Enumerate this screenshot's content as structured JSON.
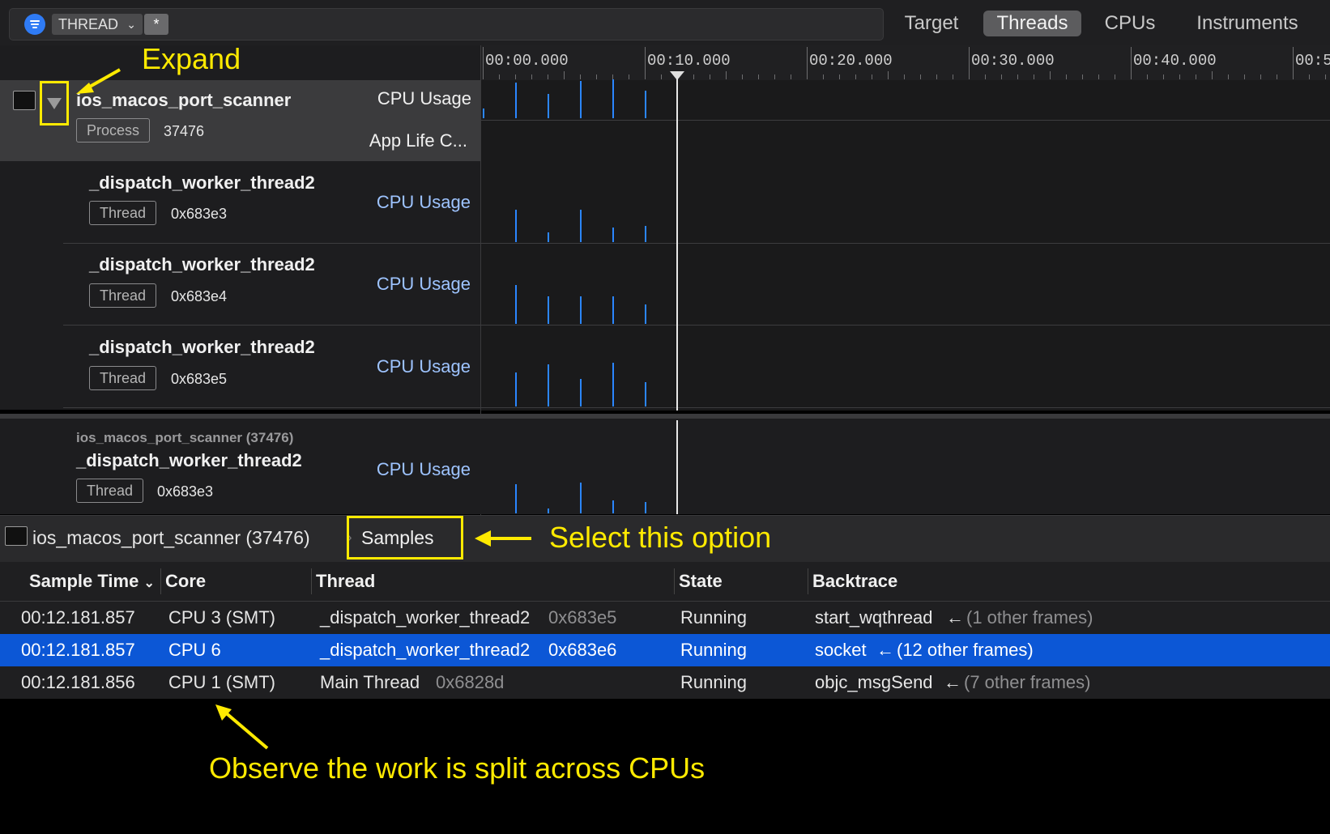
{
  "toolbar": {
    "filter_icon": "filter-icon",
    "thread_chip": "THREAD",
    "star_chip": "*",
    "segments": [
      "Target",
      "Threads",
      "CPUs",
      "Instruments"
    ],
    "selected_segment": "Threads"
  },
  "ruler": {
    "ticks": [
      "00:00.000",
      "00:10.000",
      "00:20.000",
      "00:30.000",
      "00:40.000",
      "00:5"
    ]
  },
  "tracks": {
    "process": {
      "name": "ios_macos_port_scanner",
      "badge": "Process",
      "pid": "37476",
      "lane1": "CPU Usage",
      "lane2": "App Life C..."
    },
    "threads": [
      {
        "name": "_dispatch_worker_thread2",
        "badge": "Thread",
        "id": "0x683e3",
        "lane": "CPU Usage"
      },
      {
        "name": "_dispatch_worker_thread2",
        "badge": "Thread",
        "id": "0x683e4",
        "lane": "CPU Usage"
      },
      {
        "name": "_dispatch_worker_thread2",
        "badge": "Thread",
        "id": "0x683e5",
        "lane": "CPU Usage"
      }
    ],
    "pinned": {
      "process": "ios_macos_port_scanner (37476)",
      "name": "_dispatch_worker_thread2",
      "badge": "Thread",
      "id": "0x683e3",
      "lane": "CPU Usage"
    }
  },
  "summary": {
    "target": "ios_macos_port_scanner (37476)",
    "detail": "Samples"
  },
  "table": {
    "headers": [
      "Sample Time",
      "Core",
      "Thread",
      "State",
      "Backtrace"
    ],
    "rows": [
      {
        "time": "00:12.181.857",
        "core": "CPU 3 (SMT)",
        "thread": "_dispatch_worker_thread2",
        "tid": "0x683e5",
        "state": "Running",
        "frame": "start_wqthread",
        "other": "(1 other frames)"
      },
      {
        "time": "00:12.181.857",
        "core": "CPU 6",
        "thread": "_dispatch_worker_thread2",
        "tid": "0x683e6",
        "state": "Running",
        "frame": "socket",
        "other": "(12 other frames)"
      },
      {
        "time": "00:12.181.856",
        "core": "CPU 1 (SMT)",
        "thread": "Main Thread",
        "tid": "0x6828d",
        "state": "Running",
        "frame": "objc_msgSend",
        "other": "(7 other frames)"
      }
    ]
  },
  "annotations": {
    "expand": "Expand",
    "select": "Select this option",
    "observe": "Observe the work is split across CPUs"
  },
  "colors": {
    "accent": "#2b86ff",
    "selection": "#0c57d6",
    "annotation": "#ffea00"
  }
}
